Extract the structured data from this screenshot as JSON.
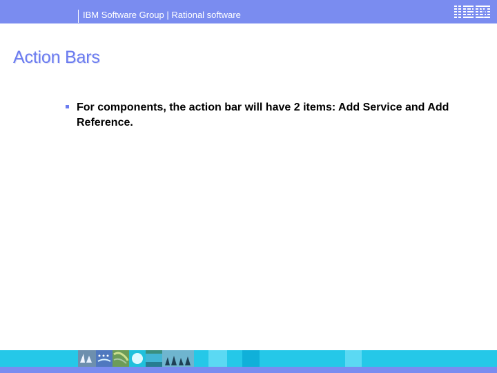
{
  "header": {
    "label": "IBM Software Group | Rational software",
    "logo": "IBM"
  },
  "title": "Action Bars",
  "bullets": [
    {
      "text": "For components, the action bar will have 2 items: Add Service and Add Reference."
    }
  ],
  "colors": {
    "header": "#7a8cf0",
    "title": "#6b7cf0",
    "footer": "#25c8e8",
    "bullet": "#6b7cf0"
  }
}
